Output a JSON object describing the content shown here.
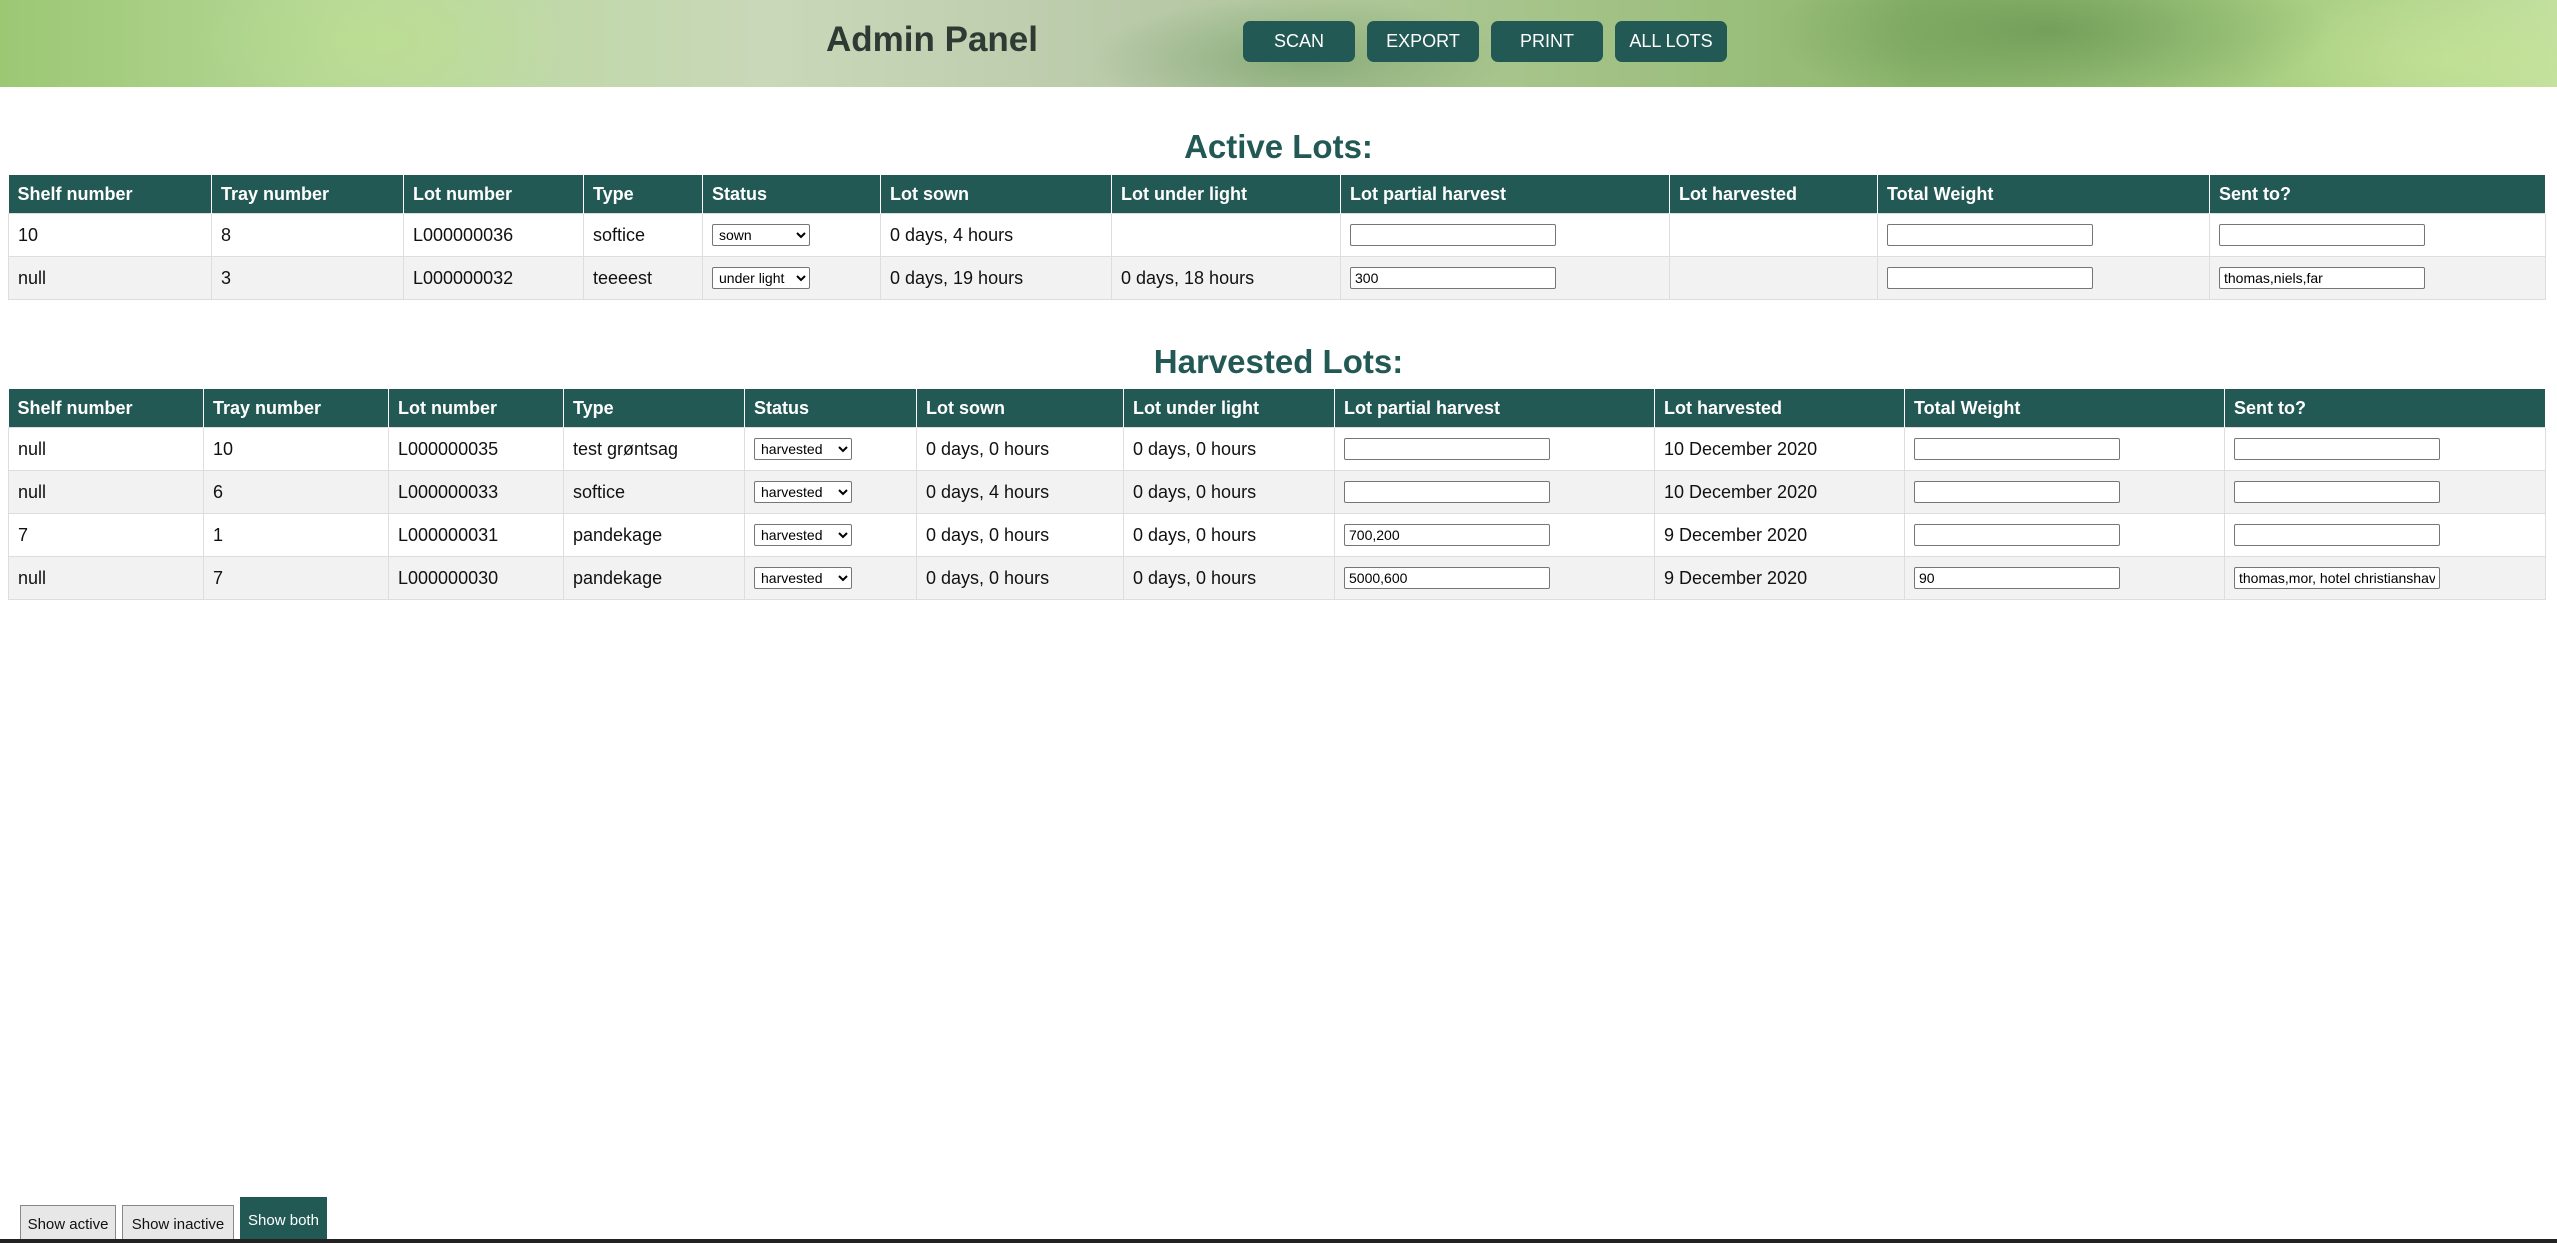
{
  "header": {
    "title": "Admin Panel",
    "nav": [
      "SCAN",
      "EXPORT",
      "PRINT",
      "ALL LOTS"
    ]
  },
  "columns": {
    "shelf": "Shelf number",
    "tray": "Tray number",
    "lot": "Lot number",
    "type": "Type",
    "status": "Status",
    "sown": "Lot sown",
    "under_light": "Lot under light",
    "partial": "Lot partial harvest",
    "harvested": "Lot harvested",
    "weight": "Total Weight",
    "sent": "Sent to?"
  },
  "active": {
    "title": "Active Lots:",
    "rows": [
      {
        "shelf": "10",
        "tray": "8",
        "lot": "L000000036",
        "type": "softice",
        "status": "sown",
        "sown": "0 days, 4 hours",
        "under_light": "",
        "partial": "",
        "harvested": "",
        "weight": "",
        "sent": ""
      },
      {
        "shelf": "null",
        "tray": "3",
        "lot": "L000000032",
        "type": "teeeest",
        "status": "under light",
        "sown": "0 days, 19 hours",
        "under_light": "0 days, 18 hours",
        "partial": "300",
        "harvested": "",
        "weight": "",
        "sent": "thomas,niels,far"
      }
    ]
  },
  "harvested_lots": {
    "title": "Harvested Lots:",
    "rows": [
      {
        "shelf": "null",
        "tray": "10",
        "lot": "L000000035",
        "type": "test grøntsag",
        "status": "harvested",
        "sown": "0 days, 0 hours",
        "under_light": "0 days, 0 hours",
        "partial": "",
        "harvested": "10 December 2020",
        "weight": "",
        "sent": ""
      },
      {
        "shelf": "null",
        "tray": "6",
        "lot": "L000000033",
        "type": "softice",
        "status": "harvested",
        "sown": "0 days, 4 hours",
        "under_light": "0 days, 0 hours",
        "partial": "",
        "harvested": "10 December 2020",
        "weight": "",
        "sent": ""
      },
      {
        "shelf": "7",
        "tray": "1",
        "lot": "L000000031",
        "type": "pandekage",
        "status": "harvested",
        "sown": "0 days, 0 hours",
        "under_light": "0 days, 0 hours",
        "partial": "700,200",
        "harvested": "9 December 2020",
        "weight": "",
        "sent": ""
      },
      {
        "shelf": "null",
        "tray": "7",
        "lot": "L000000030",
        "type": "pandekage",
        "status": "harvested",
        "sown": "0 days, 0 hours",
        "under_light": "0 days, 0 hours",
        "partial": "5000,600",
        "harvested": "9 December 2020",
        "weight": "90",
        "sent": "thomas,mor, hotel christianshavn"
      }
    ]
  },
  "footer": {
    "buttons": [
      "Show active",
      "Show inactive",
      "Show both"
    ],
    "selected": "Show both"
  },
  "colors": {
    "accent": "#225954",
    "row_alt": "#f2f2f2"
  }
}
